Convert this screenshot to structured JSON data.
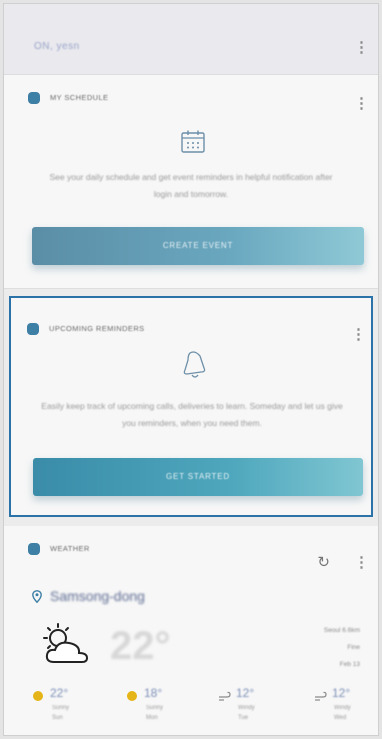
{
  "header": {
    "title": "ON, yesn"
  },
  "schedule_card": {
    "title": "MY SCHEDULE",
    "description": "See your daily schedule and get event reminders in helpful notification after login and tomorrow.",
    "button_label": "CREATE EVENT"
  },
  "reminders_card": {
    "title": "UPCOMING REMINDERS",
    "description": "Easily keep track of upcoming calls, deliveries to learn. Someday and let us give you reminders, when you need them.",
    "button_label": "GET STARTED"
  },
  "weather_card": {
    "title": "WEATHER",
    "location": "Samsong-dong",
    "current_temp": "22°",
    "side_info": [
      "Seoul 6.6km",
      "Fine",
      "Feb 13"
    ],
    "forecast": [
      {
        "temp": "22°",
        "line1": "Sunny",
        "line2": "Sun",
        "icon": "sun-icon"
      },
      {
        "temp": "18°",
        "line1": "Sunny",
        "line2": "Mon",
        "icon": "sun-icon"
      },
      {
        "temp": "12°",
        "line1": "Windy",
        "line2": "Tue",
        "icon": "wind-icon"
      },
      {
        "temp": "12°",
        "line1": "Windy",
        "line2": "Wed",
        "icon": "wind-icon"
      }
    ]
  },
  "colors": {
    "accent": "#2a72a8",
    "button": "#5a9ab2",
    "sun": "#e5b418"
  }
}
